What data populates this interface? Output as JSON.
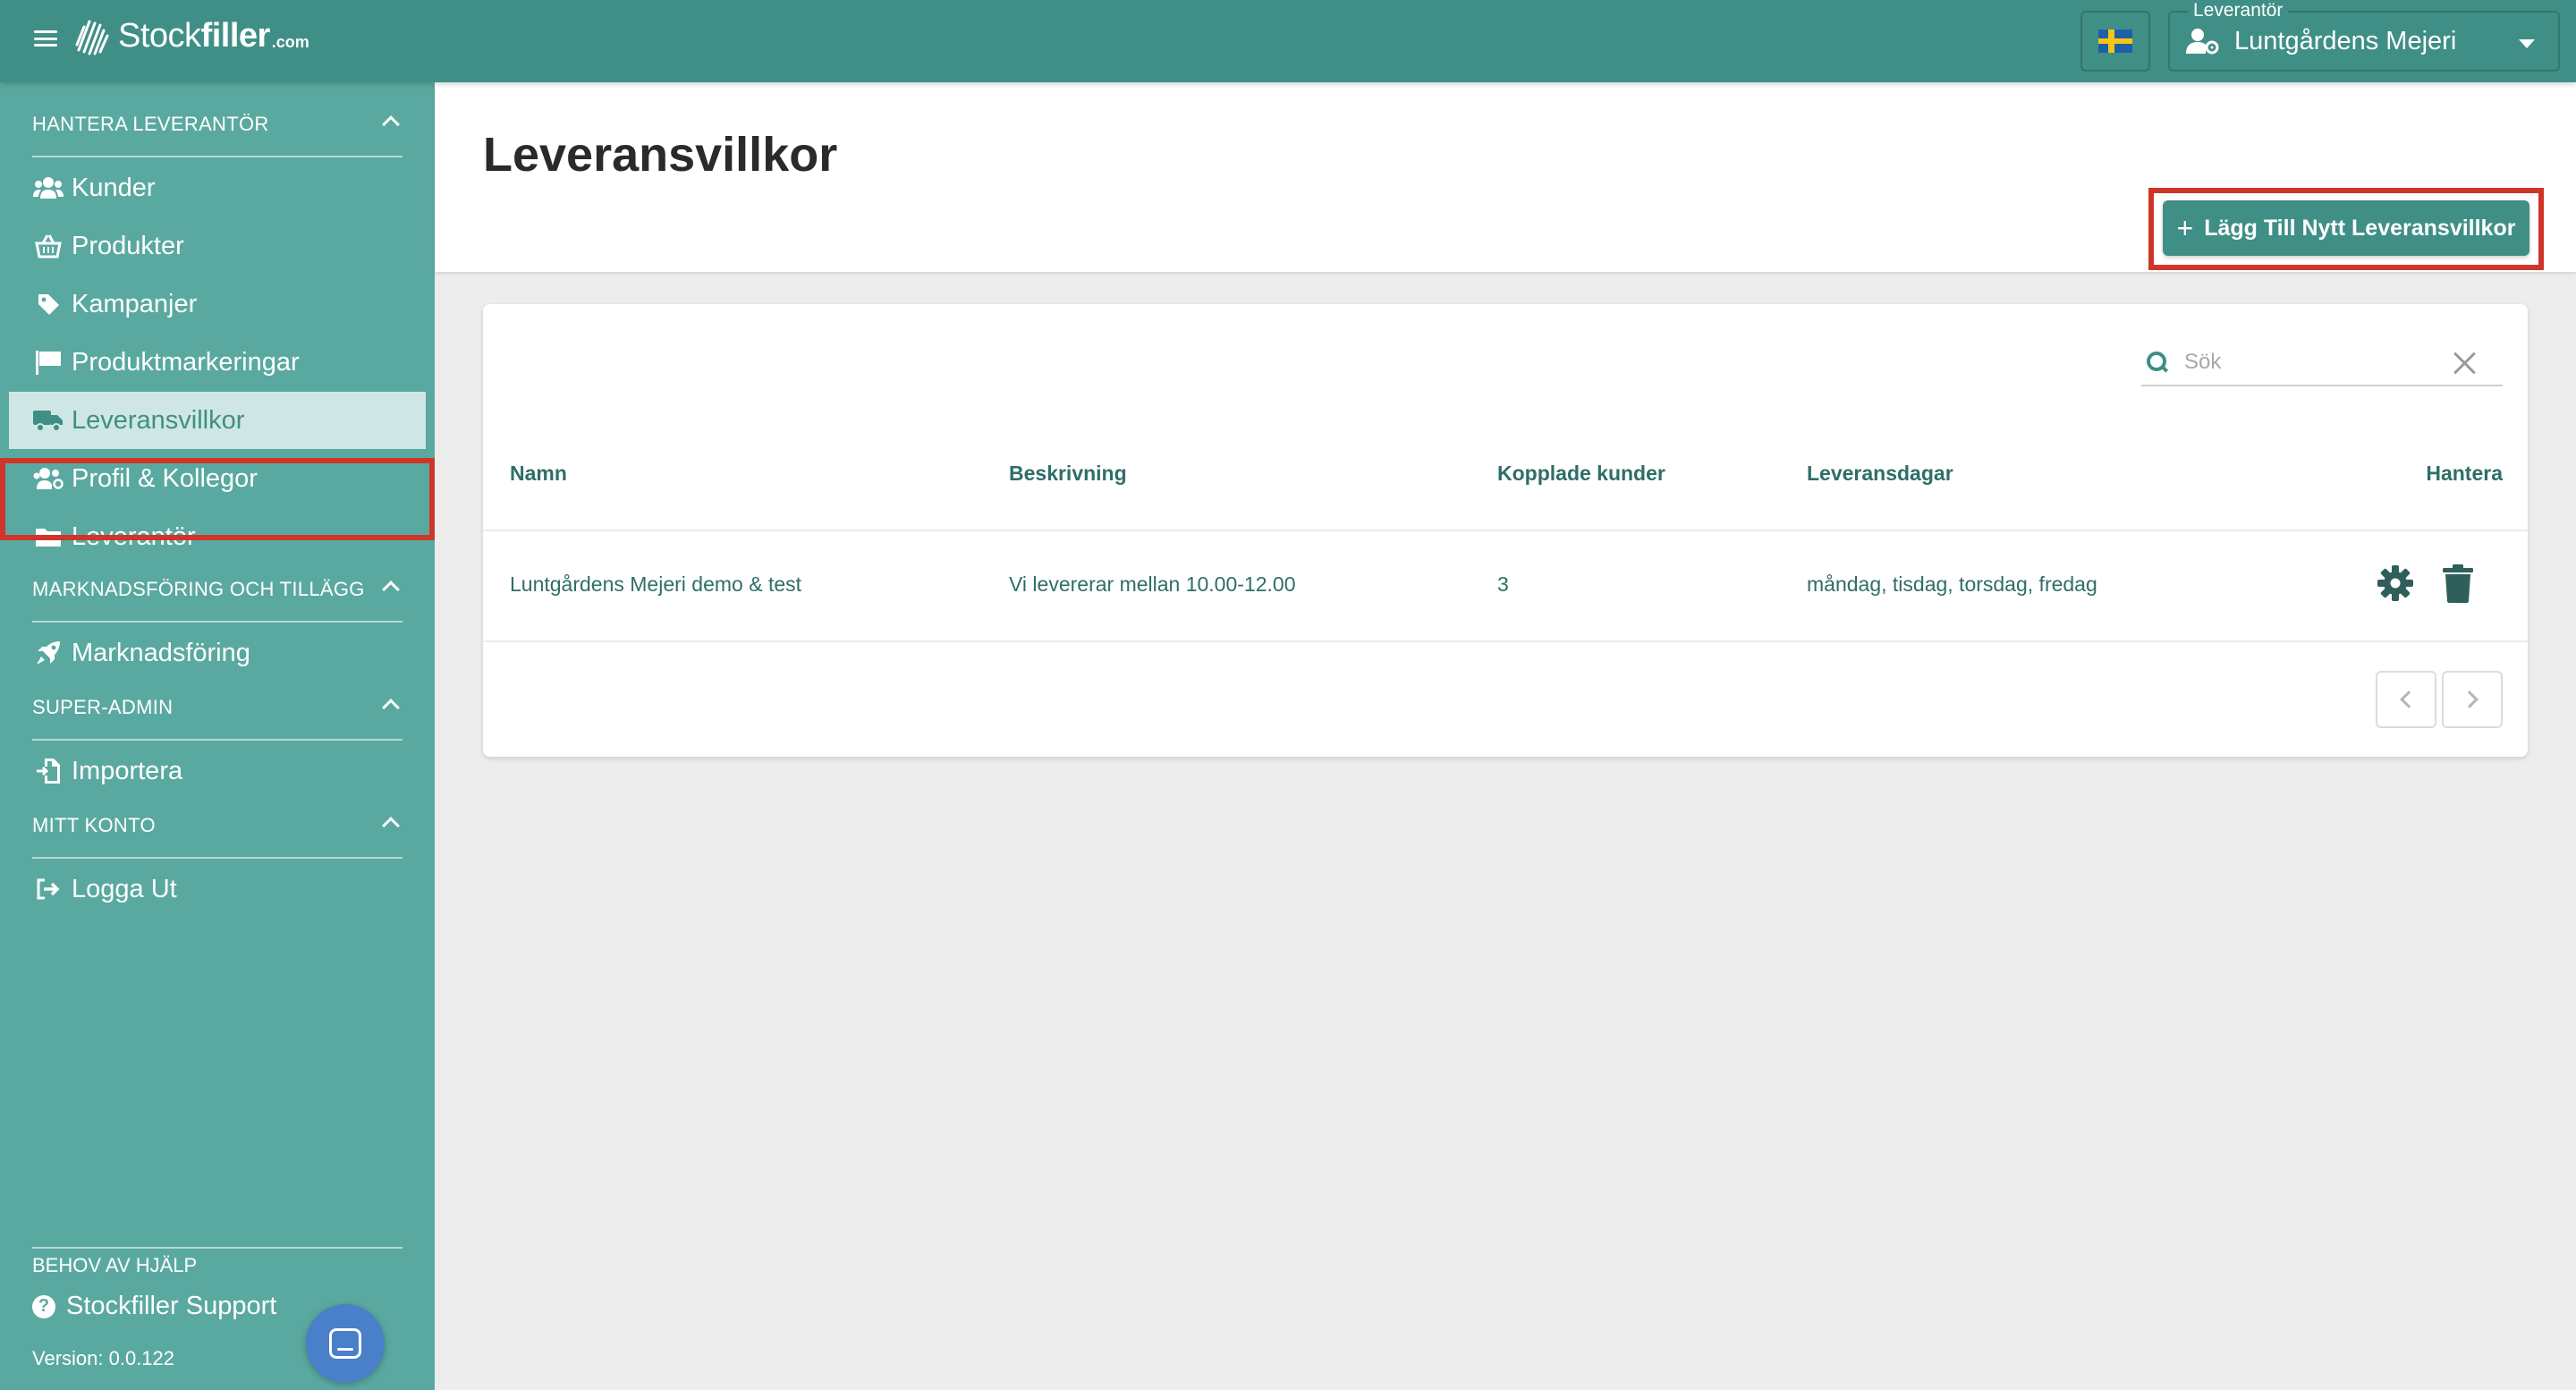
{
  "topbar": {
    "brand_main": "Stock",
    "brand_bold": "filler",
    "brand_suffix": ".com",
    "supplier_legend": "Leverantör",
    "supplier_name": "Luntgårdens Mejeri",
    "flag_icon": "swedish-flag-icon"
  },
  "sidebar": {
    "sections": [
      {
        "title": "HANTERA LEVERANTÖR"
      },
      {
        "title": "MARKNADSFÖRING OCH TILLÄGG"
      },
      {
        "title": "SUPER-ADMIN"
      },
      {
        "title": "MITT KONTO"
      }
    ],
    "items": [
      {
        "label": "Kunder",
        "icon": "users-icon"
      },
      {
        "label": "Produkter",
        "icon": "basket-icon"
      },
      {
        "label": "Kampanjer",
        "icon": "tag-icon"
      },
      {
        "label": "Produktmarkeringar",
        "icon": "flag-icon"
      },
      {
        "label": "Leveransvillkor",
        "icon": "truck-icon",
        "active": true
      },
      {
        "label": "Profil & Kollegor",
        "icon": "users-gear-icon"
      },
      {
        "label": "Leverantör",
        "icon": "folder-icon"
      },
      {
        "label": "Marknadsföring",
        "icon": "rocket-icon"
      },
      {
        "label": "Importera",
        "icon": "import-icon"
      },
      {
        "label": "Logga Ut",
        "icon": "logout-icon"
      }
    ],
    "help_title": "BEHOV AV HJÄLP",
    "support_label": "Stockfiller Support",
    "version": "Version: 0.0.122"
  },
  "main": {
    "title": "Leveransvillkor",
    "add_button": "Lägg Till Nytt Leveransvillkor",
    "search": {
      "placeholder": "Sök",
      "value": ""
    },
    "columns": [
      "Namn",
      "Beskrivning",
      "Kopplade kunder",
      "Leveransdagar",
      "Hantera"
    ],
    "rows": [
      {
        "name": "Luntgårdens Mejeri demo & test",
        "description": "Vi levererar mellan 10.00-12.00",
        "linked_customers": "3",
        "delivery_days": "måndag, tisdag, torsdag, fredag"
      }
    ]
  },
  "colors": {
    "primary": "#3f8f86",
    "sidebar": "#5aa9a0",
    "active_item_bg": "#cfe7e4",
    "highlight": "#d0352a"
  }
}
